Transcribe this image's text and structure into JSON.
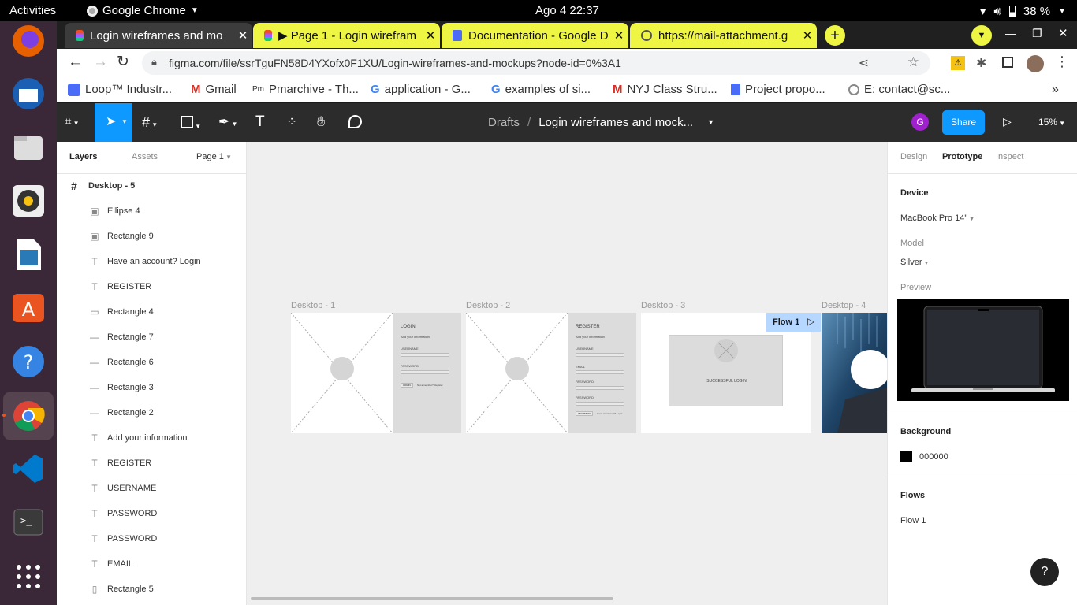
{
  "topbar": {
    "activities": "Activities",
    "app": "Google Chrome",
    "clock": "Ago 4  22:37",
    "battery": "38 %"
  },
  "tabs": [
    {
      "title": "Login wireframes and mo",
      "active": true
    },
    {
      "title": "▶ Page 1 - Login wirefram"
    },
    {
      "title": "Documentation - Google D"
    },
    {
      "title": "https://mail-attachment.g"
    }
  ],
  "address": {
    "url": "figma.com/file/ssrTguFN58D4YXofx0F1XU/Login-wireframes-and-mockups?node-id=0%3A1"
  },
  "bookmarks": [
    "Loop™ Industr...",
    "Gmail",
    "Pmarchive - Th...",
    "application - G...",
    "examples of si...",
    "NYJ Class Stru...",
    "Project propo...",
    "E: contact@sc..."
  ],
  "figma": {
    "breadcrumb_root": "Drafts",
    "breadcrumb_sep": "/",
    "file_name": "Login wireframes and mock...",
    "avatar_letter": "G",
    "share": "Share",
    "zoom": "15%"
  },
  "left": {
    "tabs": [
      "Layers",
      "Assets"
    ],
    "page": "Page 1",
    "root": "Desktop - 5",
    "layers": [
      {
        "name": "Ellipse 4",
        "icon": "image"
      },
      {
        "name": "Rectangle 9",
        "icon": "image"
      },
      {
        "name": "Have an account? Login",
        "icon": "text"
      },
      {
        "name": "REGISTER",
        "icon": "text"
      },
      {
        "name": "Rectangle 4",
        "icon": "rect"
      },
      {
        "name": "Rectangle 7",
        "icon": "line"
      },
      {
        "name": "Rectangle 6",
        "icon": "line"
      },
      {
        "name": "Rectangle 3",
        "icon": "line"
      },
      {
        "name": "Rectangle 2",
        "icon": "line"
      },
      {
        "name": "Add your information",
        "icon": "text"
      },
      {
        "name": "REGISTER",
        "icon": "text"
      },
      {
        "name": "USERNAME",
        "icon": "text"
      },
      {
        "name": "PASSWORD",
        "icon": "text"
      },
      {
        "name": "PASSWORD",
        "icon": "text"
      },
      {
        "name": "EMAIL",
        "icon": "text"
      },
      {
        "name": "Rectangle 5",
        "icon": "vrect"
      }
    ]
  },
  "canvas": {
    "frames": [
      "Desktop - 1",
      "Desktop - 2",
      "Desktop - 3",
      "Desktop - 4"
    ],
    "flow_badge": "Flow 1",
    "login": {
      "title": "LOGIN",
      "sub": "Add your information",
      "username": "USERNAME",
      "password": "PASSWORD",
      "btn": "LOGIN",
      "link": "Not a member? Register"
    },
    "register": {
      "title": "REGISTER",
      "sub": "Add your information",
      "username": "USERNAME",
      "email": "EMAIL",
      "password": "PASSWORD",
      "password2": "PASSWORD",
      "btn": "REGISTER",
      "link": "Have an account? Login"
    },
    "success": "SUCCESSFUL LOGIN"
  },
  "right": {
    "tabs": [
      "Design",
      "Prototype",
      "Inspect"
    ],
    "device_heading": "Device",
    "device": "MacBook Pro 14\"",
    "model_label": "Model",
    "model": "Silver",
    "preview_label": "Preview",
    "bg_heading": "Background",
    "bg_value": "000000",
    "flows_heading": "Flows",
    "flow": "Flow 1",
    "help": "?"
  }
}
